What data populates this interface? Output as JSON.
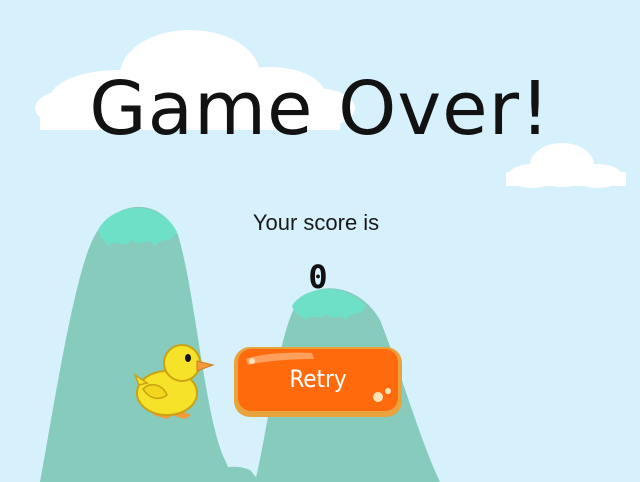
{
  "game": {
    "title": "Game Over!",
    "score_label": "Your score is",
    "score_value": "0",
    "retry_label": "Retry"
  },
  "colors": {
    "sky": "#d6f1fb",
    "cloud": "#ffffff",
    "hill": "#86cbbc",
    "hill_cap": "#6fe0c8",
    "button": "#ff6a0d",
    "button_border": "#e8a33c",
    "duck": "#f7e22a",
    "beak": "#f39a3a"
  },
  "icons": {
    "duck": "duck-character-icon",
    "retry": "retry-button"
  }
}
